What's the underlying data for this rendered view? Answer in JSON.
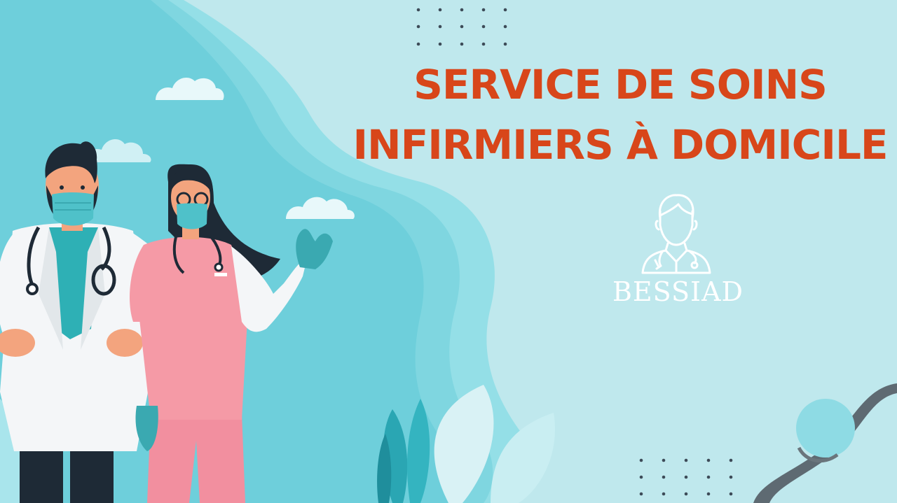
{
  "headline": {
    "line1": "SERVICE DE SOINS",
    "line2": "INFIRMIERS À DOMICILE"
  },
  "logo": {
    "brand_name": "BESSIAD",
    "icon": "doctor-outline-icon"
  },
  "colors": {
    "headline": "#d8461a",
    "background": "#bfe8ed",
    "wave": "#7fd6e0",
    "coat": "#f4f6f8",
    "scrubs": "#f59aa6",
    "mask": "#4fc1c9"
  }
}
